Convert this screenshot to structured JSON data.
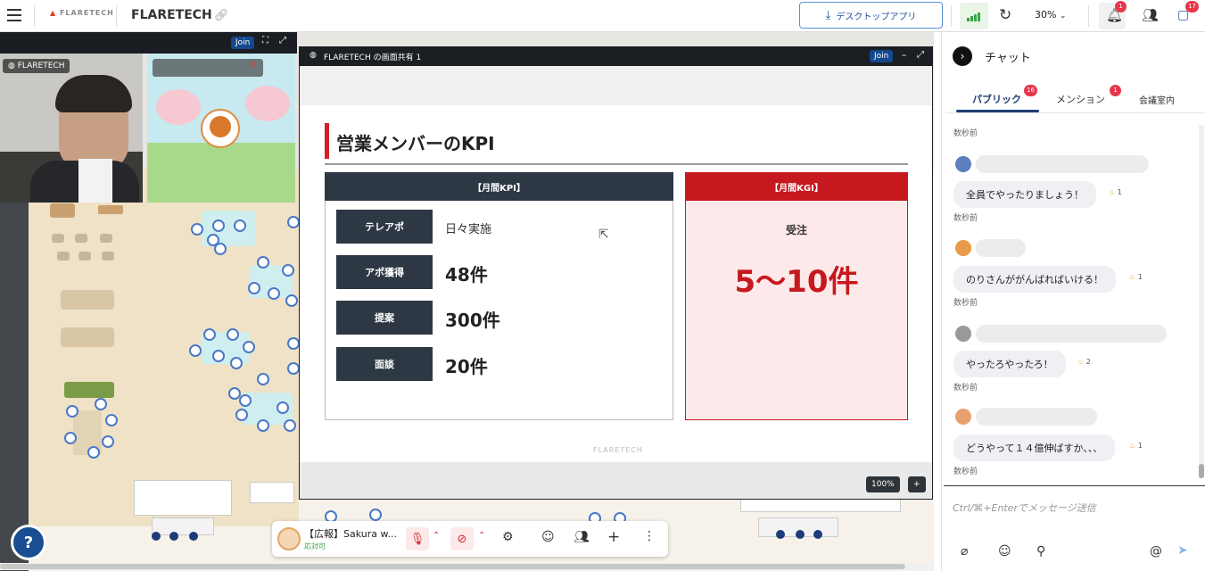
{
  "app": {
    "logo_text": "FLARETECH",
    "workspace_name": "FLARETECH"
  },
  "topbar": {
    "desktop_app_label": "デスクトップアプリ",
    "zoom_label": "30%",
    "notifications_count": "1",
    "chat_count": "17"
  },
  "video": {
    "join_label": "Join",
    "tile1_label": "FLARETECH"
  },
  "share": {
    "title": "FLARETECH の画面共有 1",
    "join_label": "Join",
    "zoom_label": "100%",
    "zoom_plus": "+",
    "slide": {
      "title": "営業メンバーのKPI",
      "kpi_header": "【月間KPI】",
      "kgi_header": "【月間KGI】",
      "kpi_rows": [
        {
          "label": "テレアポ",
          "value": "日々実施"
        },
        {
          "label": "アポ獲得",
          "value": "48件"
        },
        {
          "label": "提案",
          "value": "300件"
        },
        {
          "label": "面談",
          "value": "20件"
        }
      ],
      "kgi_label": "受注",
      "kgi_value": "5〜10件",
      "footer": "FLARETECH"
    }
  },
  "toolbar": {
    "user_name": "【広報】Sakura w...",
    "user_status": "応対可"
  },
  "chat": {
    "title": "チャット",
    "tabs": [
      {
        "label": "パブリック",
        "badge": "16"
      },
      {
        "label": "メンション",
        "badge": "1"
      },
      {
        "label": "会議室内",
        "badge": ""
      }
    ],
    "top_timestamp": "数秒前",
    "messages": [
      {
        "text": "全員でやったりましょう！",
        "reaction": "1",
        "timestamp": "数秒前"
      },
      {
        "text": "のりさんががんばればいける！",
        "reaction": "1",
        "timestamp": "数秒前"
      },
      {
        "text": "やったろやったろ！",
        "reaction": "2",
        "timestamp": "数秒前"
      },
      {
        "text": "どうやって１４億伸ばすか、、、",
        "reaction": "1",
        "timestamp": "数秒前"
      }
    ],
    "input_placeholder": "Ctrl/⌘+Enterでメッセージ送信"
  },
  "colors": {
    "brand_red": "#d11f28",
    "navy": "#2d3844",
    "accent_blue": "#1f3d73"
  },
  "icons": [
    "menu-icon",
    "link-icon",
    "download-icon",
    "signal-icon",
    "refresh-icon",
    "bell-icon",
    "users-icon",
    "chat-icon",
    "mic-off-icon",
    "camera-off-icon",
    "settings-icon",
    "emoji-icon",
    "group-icon",
    "plus-icon",
    "more-icon",
    "attach-icon",
    "pin-icon",
    "mention-icon",
    "send-icon"
  ]
}
